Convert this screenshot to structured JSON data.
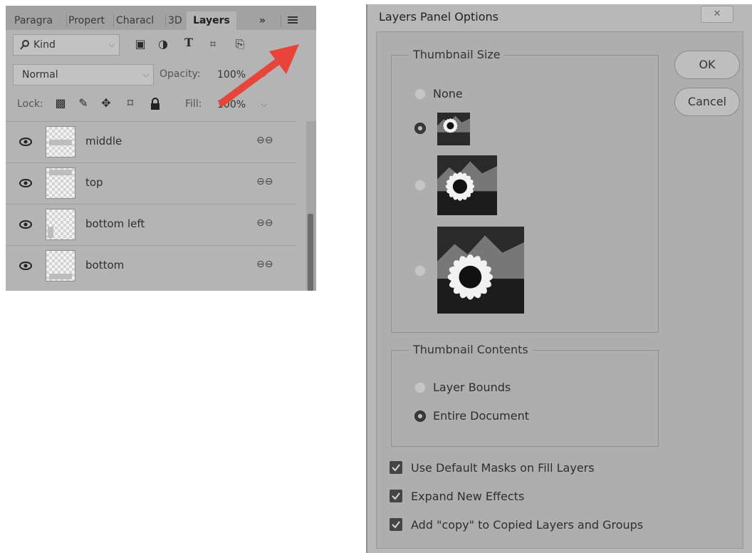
{
  "layers_panel": {
    "tabs": [
      {
        "label": "Paragra"
      },
      {
        "label": "Propert"
      },
      {
        "label": "Characl"
      },
      {
        "label": "3D"
      },
      {
        "label": "Layers"
      }
    ],
    "overflow_label": "»",
    "filter": {
      "label": "Kind"
    },
    "blend": {
      "value": "Normal",
      "opacity_label": "Opacity:",
      "opacity_value": "100%"
    },
    "lock_label": "Lock:",
    "fill_label": "Fill:",
    "fill_value": "100%",
    "layers": [
      {
        "name": "middle"
      },
      {
        "name": "top"
      },
      {
        "name": "bottom left"
      },
      {
        "name": "bottom"
      }
    ],
    "accent_color": "#e8443a"
  },
  "dialog": {
    "title": "Layers Panel Options",
    "close_label": "✕",
    "thumbnail_size": {
      "title": "Thumbnail Size",
      "none_label": "None",
      "selected": "small"
    },
    "thumbnail_contents": {
      "title": "Thumbnail Contents",
      "layer_bounds_label": "Layer Bounds",
      "entire_document_label": "Entire Document",
      "selected": "entire_document"
    },
    "ok_label": "OK",
    "cancel_label": "Cancel",
    "checkboxes": [
      {
        "label": "Use Default Masks on Fill Layers",
        "checked": true
      },
      {
        "label": "Expand New Effects",
        "checked": true
      },
      {
        "label": "Add \"copy\" to Copied Layers and Groups",
        "checked": true
      }
    ]
  }
}
